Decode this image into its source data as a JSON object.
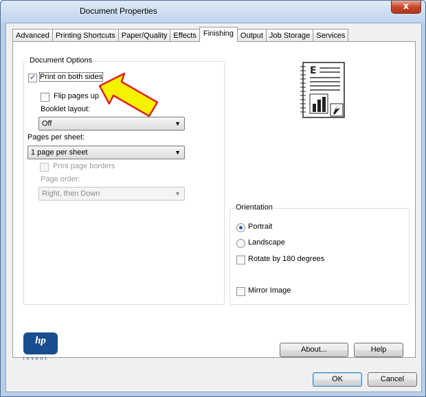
{
  "window": {
    "title": "Document Properties",
    "close_label": "x"
  },
  "tabs": [
    "Advanced",
    "Printing Shortcuts",
    "Paper/Quality",
    "Effects",
    "Finishing",
    "Output",
    "Job Storage",
    "Services"
  ],
  "active_tab": "Finishing",
  "document_options": {
    "group_label": "Document Options",
    "print_both_sides": {
      "label": "Print on both sides",
      "checked": true
    },
    "flip_pages_up": {
      "label": "Flip pages up",
      "checked": false
    },
    "booklet_layout": {
      "label": "Booklet layout:",
      "value": "Off"
    },
    "pages_per_sheet": {
      "label": "Pages per sheet:",
      "value": "1 page per sheet"
    },
    "print_page_borders": {
      "label": "Print page borders",
      "checked": false,
      "disabled": true
    },
    "page_order": {
      "label": "Page order:",
      "value": "Right, then Down",
      "disabled": true
    }
  },
  "orientation": {
    "group_label": "Orientation",
    "portrait": {
      "label": "Portrait",
      "selected": true
    },
    "landscape": {
      "label": "Landscape",
      "selected": false
    },
    "rotate_180": {
      "label": "Rotate by 180 degrees",
      "checked": false
    },
    "mirror_image": {
      "label": "Mirror Image",
      "checked": false
    }
  },
  "buttons": {
    "about": "About...",
    "help": "Help",
    "ok": "OK",
    "cancel": "Cancel"
  },
  "logo": {
    "hp": "hp",
    "invent": "invent"
  },
  "annotation": {
    "arrow_color": "#f5f200",
    "arrow_border": "#e02020"
  },
  "icons": {
    "preview": "document-preview-icon",
    "arrow": "yellow-arrow-icon"
  }
}
